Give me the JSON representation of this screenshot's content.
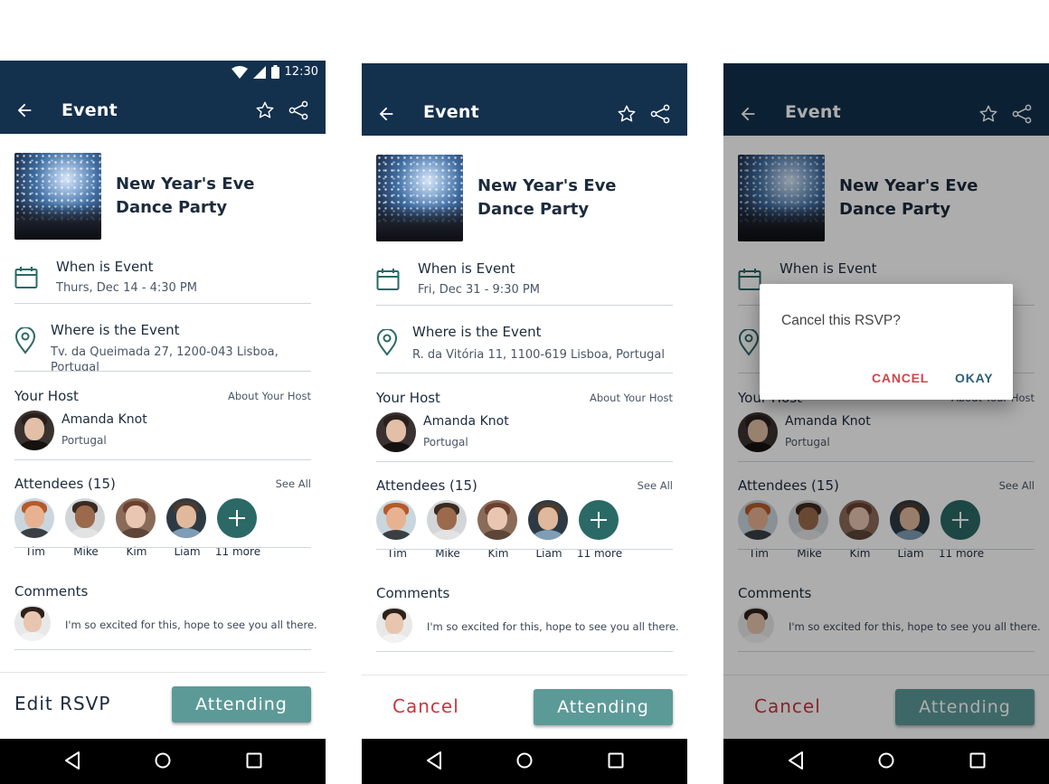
{
  "status": {
    "time": "12:30"
  },
  "appbar": {
    "title": "Event",
    "back_icon": "arrow-left-icon",
    "star_icon": "star-outline-icon",
    "share_icon": "share-icon"
  },
  "event": {
    "title": "New Year's Eve Dance Party"
  },
  "when": {
    "label": "When is Event"
  },
  "where": {
    "label": "Where is the Event"
  },
  "host": {
    "section_title": "Your Host",
    "link": "About Your Host",
    "name": "Amanda Knot",
    "location": "Portugal"
  },
  "attendees": {
    "section_title": "Attendees (15)",
    "link": "See All",
    "people": [
      {
        "name": "Tim"
      },
      {
        "name": "Mike"
      },
      {
        "name": "Kim"
      },
      {
        "name": "Liam"
      }
    ],
    "more_label": "11 more"
  },
  "comments": {
    "section_title": "Comments",
    "text": "I'm so excited for this, hope to see you all there."
  },
  "screens": {
    "s1": {
      "when_value": "Thurs, Dec 14 - 4:30 PM",
      "where_value": "Tv. da Queimada 27, 1200-043 Lisboa,",
      "where_value2": "Portugal",
      "left_btn": "Edit RSVP",
      "primary_btn": "Attending"
    },
    "s2": {
      "when_value": "Fri, Dec 31 - 9:30 PM",
      "where_value": "R. da Vitória 11, 1100-619 Lisboa, Portugal",
      "left_btn": "Cancel",
      "primary_btn": "Attending"
    },
    "s3": {
      "left_btn": "Cancel",
      "primary_btn": "Attending"
    }
  },
  "dialog": {
    "question": "Cancel this RSVP?",
    "cancel": "CANCEL",
    "okay": "OKAY"
  },
  "colors": {
    "appbar": "#13304d",
    "accent": "#5c9a98",
    "more": "#2b6966",
    "cancel": "#c9363c"
  }
}
